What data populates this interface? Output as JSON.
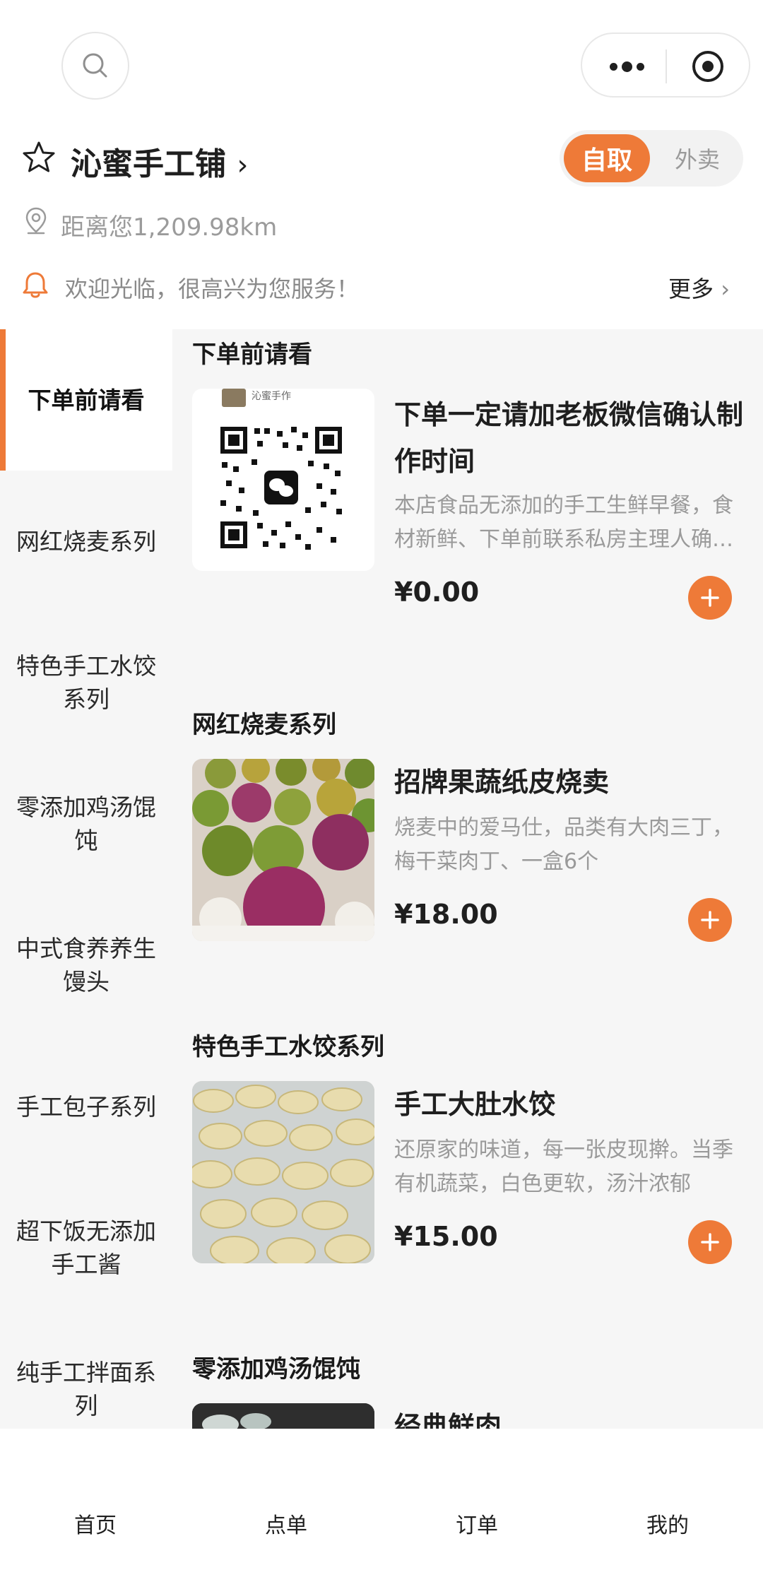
{
  "header": {
    "store_name": "沁蜜手工铺",
    "mode_options": [
      "自取",
      "外卖"
    ],
    "selected_mode": "自取",
    "distance": "距离您1,209.98km",
    "notice": "欢迎光临，很高兴为您服务！",
    "notice_more": "更多"
  },
  "categories": [
    {
      "label": "下单前请看",
      "active": true
    },
    {
      "label": "网红烧麦系列",
      "active": false
    },
    {
      "label": "特色手工水饺系列",
      "active": false
    },
    {
      "label": "零添加鸡汤馄饨",
      "active": false
    },
    {
      "label": "中式食养养生馒头",
      "active": false
    },
    {
      "label": "手工包子系列",
      "active": false
    },
    {
      "label": "超下饭无添加手工酱",
      "active": false
    },
    {
      "label": "纯手工拌面系列",
      "active": false
    }
  ],
  "sections": [
    {
      "title": "下单前请看",
      "item": {
        "name": "下单一定请加老板微信确认制作时间",
        "desc": "本店食品无添加的手工生鲜早餐，食材新鲜、下单前联系私房主理人确认制作时间",
        "price": "¥0.00",
        "image": "qr-code",
        "image_caption": "沁蜜手作"
      }
    },
    {
      "title": "网红烧麦系列",
      "item": {
        "name": "招牌果蔬纸皮烧卖",
        "desc": "烧麦中的爱马仕，品类有大肉三丁，梅干菜肉丁、一盒6个",
        "price": "¥18.00",
        "image": "shaomai-photo"
      }
    },
    {
      "title": "特色手工水饺系列",
      "item": {
        "name": "手工大肚水饺",
        "desc": "还原家的味道，每一张皮现擀。当季有机蔬菜，白色更软，汤汁浓郁",
        "price": "¥15.00",
        "image": "dumplings-photo"
      }
    },
    {
      "title": "零添加鸡汤馄饨",
      "item": {
        "name": "经典鲜肉",
        "image": "wonton-photo"
      }
    }
  ],
  "tabs": [
    "首页",
    "点单",
    "订单",
    "我的"
  ],
  "colors": {
    "accent": "#ee7a38",
    "sidebar_bg": "#f6f6f6",
    "muted_text": "#9a9a9a"
  }
}
